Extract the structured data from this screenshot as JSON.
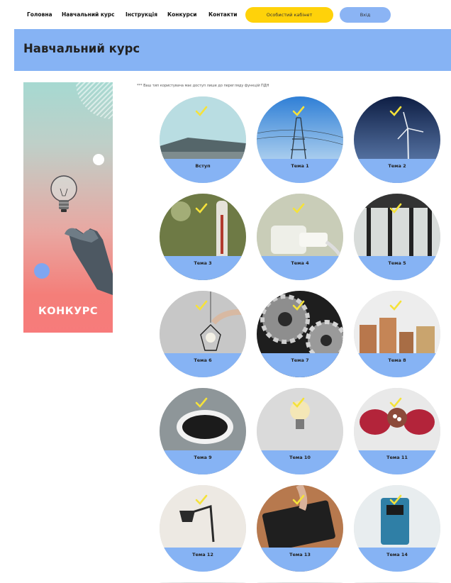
{
  "nav": {
    "items": [
      "Головна",
      "Навчальний курс",
      "Інструкція",
      "Конкурси",
      "Контакти"
    ],
    "cabinet_label": "Особистий кабінет",
    "login_label": "Вхід"
  },
  "banner": {
    "title": "Навчальний курс"
  },
  "promo": {
    "label": "КОНКУРС"
  },
  "notice": "*** Ваш тип користувача має доступ лише до перегляду функцій ПДН",
  "topics": [
    {
      "label": "Вступ",
      "completed": true
    },
    {
      "label": "Тема 1",
      "completed": true
    },
    {
      "label": "Тема 2",
      "completed": true
    },
    {
      "label": "Тема 3",
      "completed": true
    },
    {
      "label": "Тема 4",
      "completed": true
    },
    {
      "label": "Тема 5",
      "completed": true
    },
    {
      "label": "Тема 6",
      "completed": true
    },
    {
      "label": "Тема 7",
      "completed": true
    },
    {
      "label": "Тема 8",
      "completed": true
    },
    {
      "label": "Тема 9",
      "completed": true
    },
    {
      "label": "Тема 10",
      "completed": true
    },
    {
      "label": "Тема 11",
      "completed": true
    },
    {
      "label": "Тема 12",
      "completed": true
    },
    {
      "label": "Тема 13",
      "completed": true
    },
    {
      "label": "Тема 14",
      "completed": true
    }
  ],
  "colors": {
    "accent_blue": "#86B3F4",
    "accent_yellow": "#FFD20A",
    "check": "#F5E23A",
    "promo_red": "#F77B7B"
  }
}
